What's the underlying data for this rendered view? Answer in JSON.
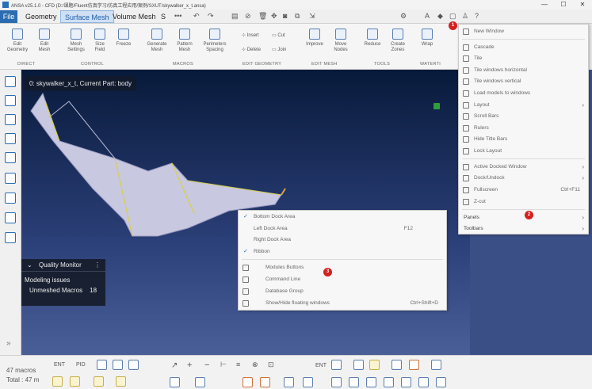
{
  "titlebar": {
    "title": "ANSA v25.1.0 - CFD (D:/课题/Fluent仿真学习/仿真工程应用/案例/SXUT/skywalker_x_t.ansa)",
    "controls": [
      "—",
      "☐",
      "✕"
    ]
  },
  "tabs": {
    "file": "File",
    "geometry": "Geometry",
    "surface_mesh": "Surface Mesh",
    "volume_mesh": "Volume Mesh",
    "truncated": "S"
  },
  "ribbon": {
    "buttons": [
      {
        "label": "Edit\nGeometry"
      },
      {
        "label": "Edit\nMesh"
      },
      {
        "label": "Mesh\nSettings"
      },
      {
        "label": "Size\nField"
      },
      {
        "label": "Freeze"
      },
      {
        "label": "Generate\nMesh"
      },
      {
        "label": "Pattern\nMesh"
      },
      {
        "label": "Perimeters\nSpacing"
      },
      {
        "label": "Improve"
      },
      {
        "label": "Move\nNodes"
      },
      {
        "label": "Reduce"
      },
      {
        "label": "Create\nZones"
      },
      {
        "label": "Wrap"
      }
    ],
    "small": {
      "insert": "Insert",
      "cut": "Cut",
      "delete": "Delete",
      "join": "Join"
    },
    "groups": {
      "direct": "DIRECT",
      "control": "CONTROL",
      "macros": "MACROS",
      "edit_geometry": "EDIT GEOMETRY",
      "edit_mesh": "EDIT MESH",
      "tools": "TOOLS",
      "watertight": "WATERTI"
    }
  },
  "viewport": {
    "label": "0: skywalker_x_t,  Current Part: body"
  },
  "quality_monitor": {
    "title": "Quality Monitor",
    "modeling_issues": "Modeling issues",
    "unmeshed_macros": "Unmeshed Macros",
    "count": "18"
  },
  "window_menu": {
    "items": [
      {
        "label": "New Window"
      },
      {
        "label": "Cascade"
      },
      {
        "label": "Tile"
      },
      {
        "label": "Tile windows horizontal"
      },
      {
        "label": "Tile windows vertical"
      },
      {
        "label": "Load models to windows"
      },
      {
        "label": "Layout"
      },
      {
        "label": "Scroll Bars"
      },
      {
        "label": "Rulers"
      },
      {
        "label": "Hide Title Bars"
      },
      {
        "label": "Lock Layout"
      },
      {
        "label": "Active Docked Window"
      },
      {
        "label": "Dock/Undock"
      },
      {
        "label": "Fullscreen",
        "shortcut": "Ctrl+F11"
      },
      {
        "label": "Z-cut"
      },
      {
        "label": "Panels"
      },
      {
        "label": "Toolbars"
      }
    ]
  },
  "panels_menu": {
    "items": [
      {
        "label": "Bottom Dock Area",
        "checked": true
      },
      {
        "label": "Left Dock Area",
        "shortcut": "F12"
      },
      {
        "label": "Right Dock Area"
      },
      {
        "label": "Ribbon",
        "checked": true
      },
      {
        "label": "Modules Buttons"
      },
      {
        "label": "Command Line"
      },
      {
        "label": "Database Group"
      },
      {
        "label": "Show/Hide floating windows",
        "shortcut": "Ctrl+Shift+D"
      }
    ]
  },
  "badges": [
    "1",
    "2",
    "3"
  ],
  "bottom": {
    "macros_stat": "47 macros",
    "total_stat": "Total : 47 m",
    "ent": "ENT",
    "pid": "PID",
    "ent2": "ENT"
  },
  "colors": {
    "accent": "#2b6cb0",
    "badge": "#d62020",
    "viewport_top": "#081a3a",
    "viewport_bottom": "#4a5e98",
    "model": "#c9c9e0"
  }
}
